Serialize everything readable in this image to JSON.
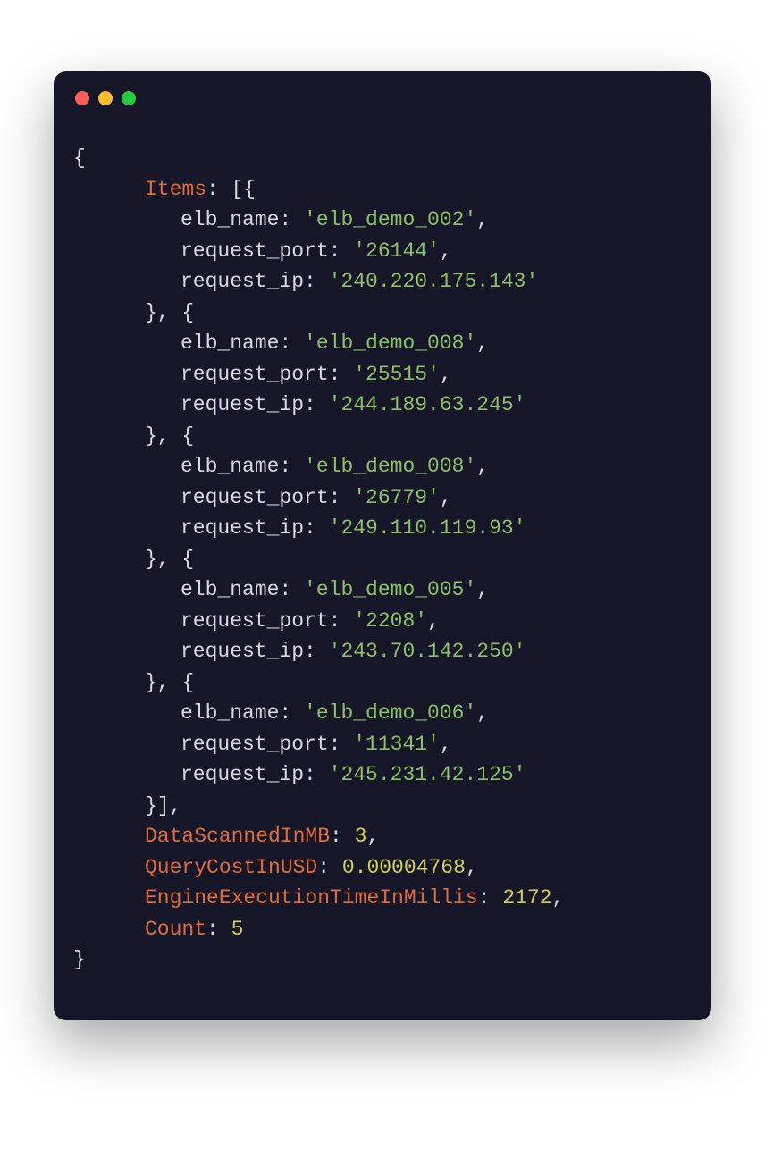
{
  "keys": {
    "items": "Items",
    "elb_name": "elb_name",
    "request_port": "request_port",
    "request_ip": "request_ip",
    "data_scanned": "DataScannedInMB",
    "query_cost": "QueryCostInUSD",
    "engine_time": "EngineExecutionTimeInMillis",
    "count": "Count"
  },
  "items": [
    {
      "elb_name": "'elb_demo_002'",
      "request_port": "'26144'",
      "request_ip": "'240.220.175.143'"
    },
    {
      "elb_name": "'elb_demo_008'",
      "request_port": "'25515'",
      "request_ip": "'244.189.63.245'"
    },
    {
      "elb_name": "'elb_demo_008'",
      "request_port": "'26779'",
      "request_ip": "'249.110.119.93'"
    },
    {
      "elb_name": "'elb_demo_005'",
      "request_port": "'2208'",
      "request_ip": "'243.70.142.250'"
    },
    {
      "elb_name": "'elb_demo_006'",
      "request_port": "'11341'",
      "request_ip": "'245.231.42.125'"
    }
  ],
  "summary": {
    "data_scanned": "3",
    "query_cost": "0.00004768",
    "engine_time": "2172",
    "count": "5"
  },
  "punct": {
    "open_brace": "{",
    "close_brace": "}",
    "open_array": "[{",
    "close_array": "}],",
    "item_sep": "}, {",
    "colon_sp": ": ",
    "comma": ","
  }
}
